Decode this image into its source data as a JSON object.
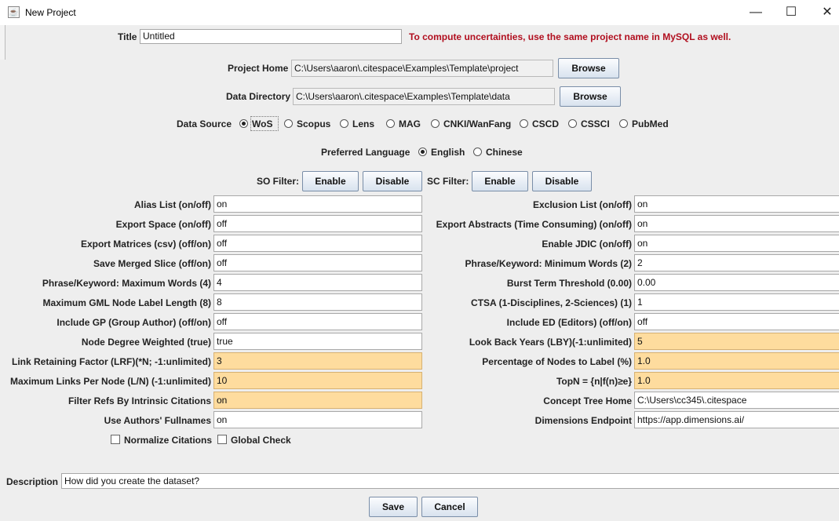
{
  "window": {
    "title": "New Project",
    "icon": "java-app-icon",
    "minimize": "—",
    "maximize": "☐",
    "close": "✕"
  },
  "title_row": {
    "label": "Title",
    "value": "Untitled",
    "warning": "To compute uncertainties, use the same project name in MySQL as well."
  },
  "project_home": {
    "label": "Project Home",
    "value": "C:\\Users\\aaron\\.citespace\\Examples\\Template\\project",
    "button": "Browse"
  },
  "data_directory": {
    "label": "Data Directory",
    "value": "C:\\Users\\aaron\\.citespace\\Examples\\Template\\data",
    "button": "Browse"
  },
  "data_source": {
    "label": "Data Source",
    "selected": "WoS",
    "options": [
      "WoS",
      "Scopus",
      "Lens",
      "MAG",
      "CNKI/WanFang",
      "CSCD",
      "CSSCI",
      "PubMed"
    ]
  },
  "language": {
    "label": "Preferred Language",
    "selected": "English",
    "options": [
      "English",
      "Chinese"
    ]
  },
  "so_filter": {
    "label": "SO Filter:",
    "enable": "Enable",
    "disable": "Disable"
  },
  "sc_filter": {
    "label": "SC Filter:",
    "enable": "Enable",
    "disable": "Disable"
  },
  "params_left": [
    {
      "label": "Alias List (on/off)",
      "value": "on",
      "highlight": false
    },
    {
      "label": "Export Space (on/off)",
      "value": "off",
      "highlight": false
    },
    {
      "label": "Export Matrices (csv) (off/on)",
      "value": "off",
      "highlight": false
    },
    {
      "label": "Save Merged Slice (off/on)",
      "value": "off",
      "highlight": false
    },
    {
      "label": "Phrase/Keyword: Maximum Words (4)",
      "value": "4",
      "highlight": false
    },
    {
      "label": "Maximum GML Node Label Length (8)",
      "value": "8",
      "highlight": false
    },
    {
      "label": "Include GP (Group Author) (off/on)",
      "value": "off",
      "highlight": false
    },
    {
      "label": "Node Degree Weighted (true)",
      "value": "true",
      "highlight": false
    },
    {
      "label": "Link Retaining Factor (LRF)(*N; -1:unlimited)",
      "value": "3",
      "highlight": true
    },
    {
      "label": "Maximum Links Per Node (L/N) (-1:unlimited)",
      "value": "10",
      "highlight": true
    },
    {
      "label": "Filter Refs By Intrinsic Citations",
      "value": "on",
      "highlight": true
    },
    {
      "label": "Use Authors' Fullnames",
      "value": "on",
      "highlight": false
    }
  ],
  "params_right": [
    {
      "label": "Exclusion List (on/off)",
      "value": "on",
      "highlight": false
    },
    {
      "label": "Export Abstracts (Time Consuming) (on/off)",
      "value": "on",
      "highlight": false
    },
    {
      "label": "Enable JDIC (on/off)",
      "value": "on",
      "highlight": false
    },
    {
      "label": "Phrase/Keyword: Minimum Words (2)",
      "value": "2",
      "highlight": false
    },
    {
      "label": "Burst Term Threshold (0.00)",
      "value": "0.00",
      "highlight": false
    },
    {
      "label": "CTSA (1-Disciplines, 2-Sciences) (1)",
      "value": "1",
      "highlight": false
    },
    {
      "label": "Include ED (Editors) (off/on)",
      "value": "off",
      "highlight": false
    },
    {
      "label": "Look Back Years (LBY)(-1:unlimited)",
      "value": "5",
      "highlight": true
    },
    {
      "label": "Percentage of Nodes to Label (%)",
      "value": "1.0",
      "highlight": true
    },
    {
      "label": "TopN = {n|f(n)≥e}",
      "value": "1.0",
      "highlight": true
    },
    {
      "label": "Concept Tree Home",
      "value": "C:\\Users\\cc345\\.citespace",
      "highlight": false
    },
    {
      "label": "Dimensions Endpoint",
      "value": "https://app.dimensions.ai/",
      "highlight": false
    }
  ],
  "checkboxes": [
    {
      "label": "Normalize Citations",
      "checked": false
    },
    {
      "label": "Global Check",
      "checked": false
    }
  ],
  "description": {
    "label": "Description",
    "value": "How did you create the dataset?"
  },
  "actions": {
    "save": "Save",
    "cancel": "Cancel"
  },
  "colors": {
    "highlight_field": "#fedc9e",
    "warning_text": "#b10f1f",
    "window_bg": "#eeeeee"
  }
}
